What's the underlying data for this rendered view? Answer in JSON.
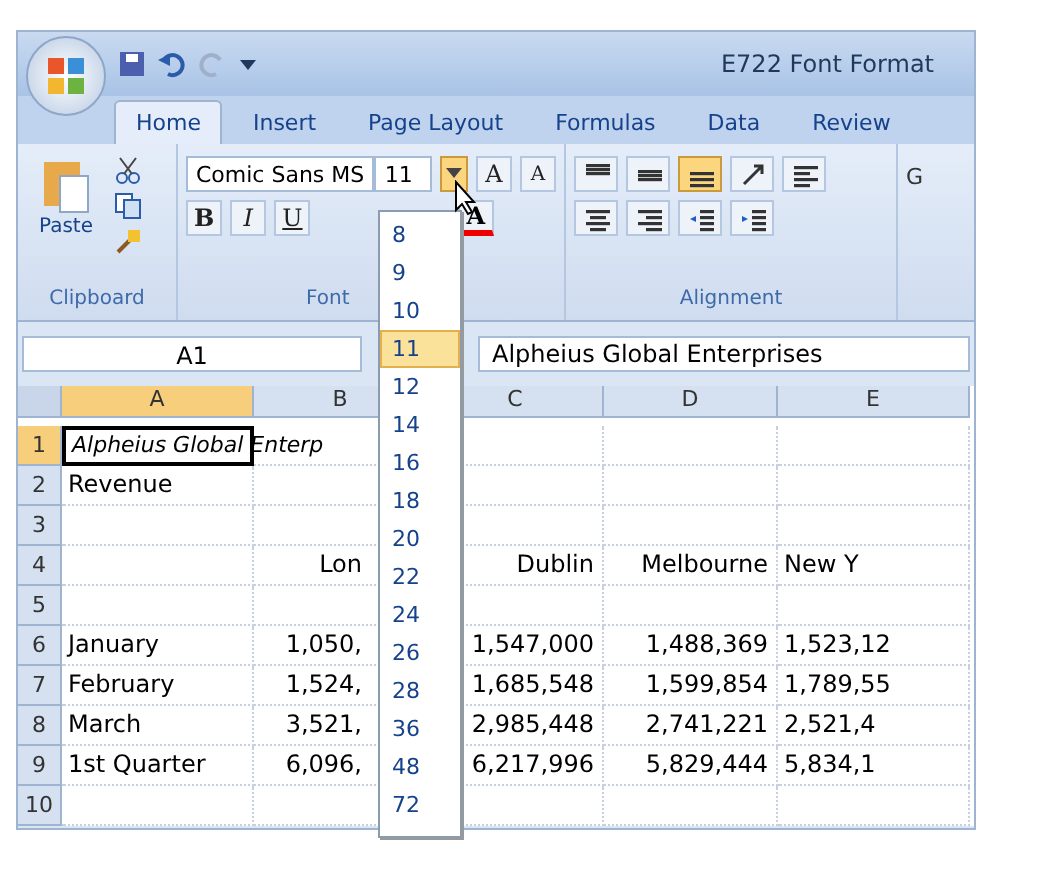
{
  "window": {
    "title": "E722 Font Format"
  },
  "tabs": [
    {
      "label": "Home",
      "selected": true
    },
    {
      "label": "Insert",
      "selected": false
    },
    {
      "label": "Page Layout",
      "selected": false
    },
    {
      "label": "Formulas",
      "selected": false
    },
    {
      "label": "Data",
      "selected": false
    },
    {
      "label": "Review",
      "selected": false
    }
  ],
  "clipboard": {
    "paste_label": "Paste",
    "group_label": "Clipboard"
  },
  "font": {
    "font_name": "Comic Sans MS",
    "font_size": "11",
    "grow": "A",
    "shrink": "A",
    "bold": "B",
    "italic": "I",
    "underline": "U",
    "color_button": "A",
    "group_label": "Font"
  },
  "alignment": {
    "group_label": "Alignment",
    "buttons": [
      {
        "kind": "top",
        "selected": false
      },
      {
        "kind": "middle",
        "selected": false
      },
      {
        "kind": "bottom",
        "selected": true
      },
      {
        "kind": "orientation",
        "selected": false
      },
      {
        "kind": "left",
        "selected": false
      },
      {
        "kind": "center",
        "selected": false
      },
      {
        "kind": "right",
        "selected": false
      },
      {
        "kind": "outdent",
        "selected": false
      },
      {
        "kind": "indent",
        "selected": false
      }
    ]
  },
  "next_group_label": "G",
  "formula_bar": {
    "name_box": "A1",
    "formula": "Alpheius Global Enterprises"
  },
  "columns": [
    {
      "label": "A",
      "selected": true
    },
    {
      "label": "B",
      "selected": false
    },
    {
      "label": "C",
      "selected": false
    },
    {
      "label": "D",
      "selected": false
    },
    {
      "label": "E",
      "selected": false
    }
  ],
  "rows": [
    {
      "number": "1",
      "selected": true,
      "cells": [
        "Alpheius Global Enterp",
        "",
        "",
        "",
        ""
      ]
    },
    {
      "number": "2",
      "selected": false,
      "cells": [
        "Revenue",
        "",
        "",
        "",
        ""
      ]
    },
    {
      "number": "3",
      "selected": false,
      "cells": [
        "",
        "",
        "",
        "",
        ""
      ]
    },
    {
      "number": "4",
      "selected": false,
      "cells": [
        "",
        "Lon",
        "Dublin",
        "Melbourne",
        "New Y"
      ]
    },
    {
      "number": "5",
      "selected": false,
      "cells": [
        "",
        "",
        "",
        "",
        ""
      ]
    },
    {
      "number": "6",
      "selected": false,
      "cells": [
        "January",
        "1,050,",
        "1,547,000",
        "1,488,369",
        "1,523,12"
      ]
    },
    {
      "number": "7",
      "selected": false,
      "cells": [
        "February",
        "1,524,",
        "1,685,548",
        "1,599,854",
        "1,789,55"
      ]
    },
    {
      "number": "8",
      "selected": false,
      "cells": [
        "March",
        "3,521,",
        "2,985,448",
        "2,741,221",
        "2,521,4"
      ]
    },
    {
      "number": "9",
      "selected": false,
      "cells": [
        "1st Quarter",
        "6,096,",
        "6,217,996",
        "5,829,444",
        "5,834,1"
      ]
    },
    {
      "number": "10",
      "selected": false,
      "cells": [
        "",
        "",
        "",
        "",
        ""
      ]
    }
  ],
  "size_list": [
    {
      "label": "8",
      "selected": false
    },
    {
      "label": "9",
      "selected": false
    },
    {
      "label": "10",
      "selected": false
    },
    {
      "label": "11",
      "selected": true
    },
    {
      "label": "12",
      "selected": false
    },
    {
      "label": "14",
      "selected": false
    },
    {
      "label": "16",
      "selected": false
    },
    {
      "label": "18",
      "selected": false
    },
    {
      "label": "20",
      "selected": false
    },
    {
      "label": "22",
      "selected": false
    },
    {
      "label": "24",
      "selected": false
    },
    {
      "label": "26",
      "selected": false
    },
    {
      "label": "28",
      "selected": false
    },
    {
      "label": "36",
      "selected": false
    },
    {
      "label": "48",
      "selected": false
    },
    {
      "label": "72",
      "selected": false
    }
  ]
}
